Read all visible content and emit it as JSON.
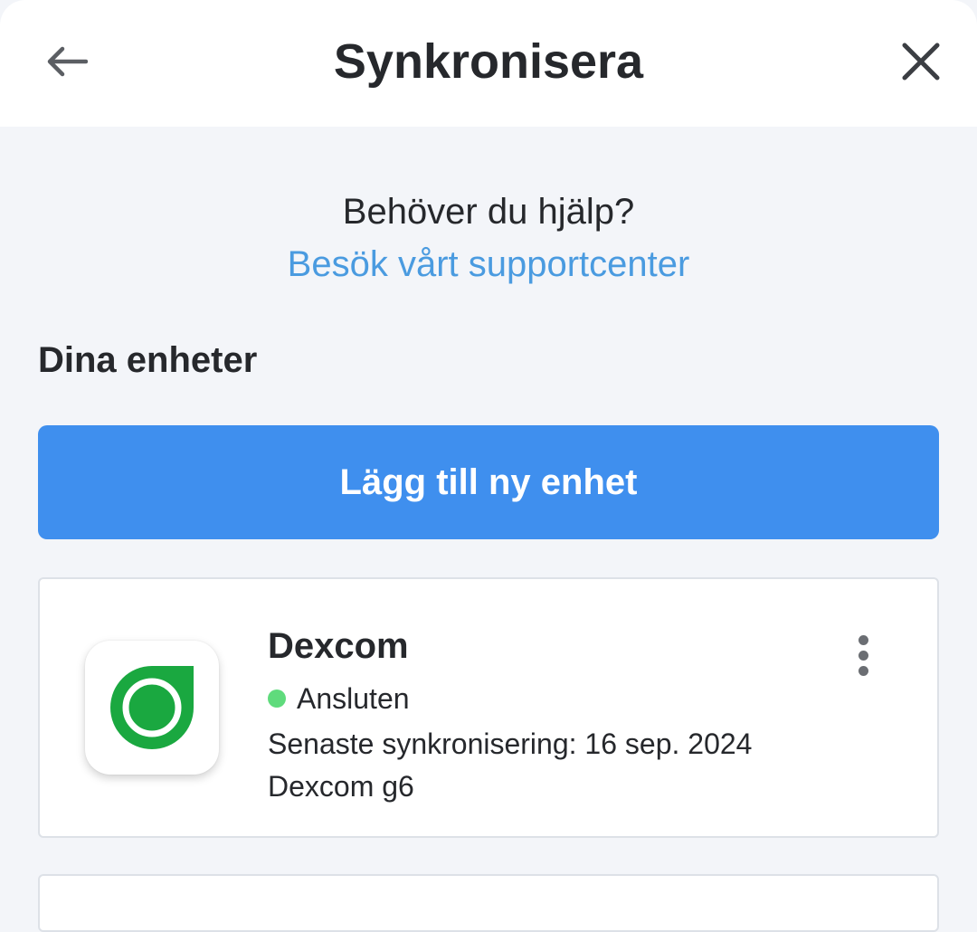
{
  "header": {
    "title": "Synkronisera",
    "back_icon": "arrow-left-icon",
    "close_icon": "close-icon"
  },
  "help": {
    "question": "Behöver du hjälp?",
    "link": "Besök vårt supportcenter"
  },
  "devices": {
    "section_title": "Dina enheter",
    "add_button": "Lägg till ny enhet",
    "items": [
      {
        "name": "Dexcom",
        "status": "Ansluten",
        "last_sync": "Senaste synkronisering: 16 sep. 2024",
        "model": "Dexcom g6",
        "logo_icon": "dexcom-logo-icon",
        "menu_icon": "more-vertical-icon"
      }
    ]
  },
  "colors": {
    "accent": "#3f8fee",
    "link": "#4a9be0",
    "status_connected": "#5fdb7c",
    "dexcom_green": "#1aa840",
    "background": "#f3f5f9"
  }
}
